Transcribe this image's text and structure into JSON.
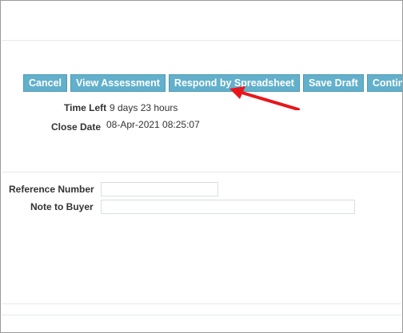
{
  "toolbar": {
    "buttons": [
      {
        "label": "Cancel"
      },
      {
        "label": "View Assessment"
      },
      {
        "label": "Respond by Spreadsheet"
      },
      {
        "label": "Save Draft"
      },
      {
        "label": "Continue"
      }
    ]
  },
  "info": {
    "time_left_label": "Time Left",
    "time_left_value": "9 days 23 hours",
    "close_date_label": "Close Date",
    "close_date_value": "08-Apr-2021 08:25:07"
  },
  "form": {
    "reference_number_label": "Reference Number",
    "reference_number_value": "",
    "note_to_buyer_label": "Note to Buyer",
    "note_to_buyer_value": ""
  },
  "annotation": {
    "arrow_color": "#e8161b",
    "arrow_icon": "red-arrow-icon"
  },
  "colors": {
    "button_bg": "#62b0cb",
    "button_text": "#ffffff"
  }
}
